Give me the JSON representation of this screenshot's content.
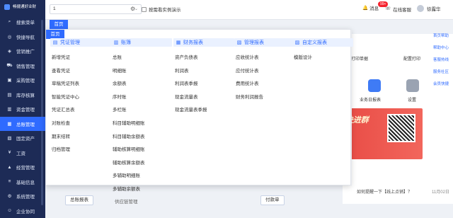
{
  "app": {
    "logo_text": "畅捷通好业财"
  },
  "sidebar": {
    "items": [
      {
        "label": "搜索菜单",
        "icon": "search-icon"
      },
      {
        "label": "快捷导航",
        "icon": "compass-icon"
      },
      {
        "label": "营销推广",
        "icon": "megaphone-icon"
      },
      {
        "label": "销售管理",
        "icon": "cart-icon"
      },
      {
        "label": "采购管理",
        "icon": "bag-icon"
      },
      {
        "label": "库存核算",
        "icon": "box-icon"
      },
      {
        "label": "资金管理",
        "icon": "wallet-icon"
      },
      {
        "label": "总账管理",
        "icon": "ledger-icon",
        "active": true
      },
      {
        "label": "固定资产",
        "icon": "building-icon"
      },
      {
        "label": "工资",
        "icon": "salary-icon"
      },
      {
        "label": "经营管理",
        "icon": "chart-icon"
      },
      {
        "label": "基础信息",
        "icon": "database-icon"
      },
      {
        "label": "系统管理",
        "icon": "settings-icon"
      },
      {
        "label": "企业协同",
        "icon": "people-icon"
      }
    ]
  },
  "topbar": {
    "company_value": "1",
    "realtime_label": "按需看实例演示",
    "message_label": "消息",
    "message_badge": "99+",
    "service_label": "在线客服",
    "user_name": "徐露华"
  },
  "main": {
    "home_tab": "首页",
    "print_label": "打印单据",
    "config_print": "配置打印",
    "tools": [
      {
        "label": "业务日报表"
      },
      {
        "label": "设置"
      }
    ],
    "promo_text": "官方VIP，快进群",
    "news": [
      {
        "text": "如何提醒一下【线上点销】？",
        "date": "11月02日"
      }
    ],
    "right_help": [
      "首页帮助",
      "帮助中心",
      "客服热线",
      "服务社区",
      "会员快捷"
    ],
    "flow": {
      "box1": "总账报表",
      "label1": "供应链管理",
      "box2": "付款单"
    }
  },
  "dropdown": {
    "tab_label": "首页",
    "columns": [
      {
        "title": "凭证管理",
        "icon": "voucher-icon",
        "items": [
          "新增凭证",
          "查看凭证",
          "草稿凭证列表",
          "智能凭证中心",
          "凭证汇总表",
          "对账检查",
          "期末结转",
          "归档管理"
        ]
      },
      {
        "title": "账簿",
        "icon": "book-icon",
        "items": [
          "总账",
          "明细账",
          "余额表",
          "序时账",
          "多栏账",
          "科目辅助明细账",
          "科目辅助余额表",
          "辅助核算明细账",
          "辅助核算余额表",
          "多辅助明细账",
          "多辅助余额表"
        ]
      },
      {
        "title": "财务报表",
        "icon": "report-icon",
        "items": [
          "资产负债表",
          "利润表",
          "利润表季报",
          "现金流量表",
          "现金流量表季报"
        ]
      },
      {
        "title": "管理报表",
        "icon": "manage-icon",
        "items": [
          "应收统计表",
          "应付统计表",
          "费用统计表",
          "财务利润报告"
        ]
      },
      {
        "title": "自定义报表",
        "icon": "custom-icon",
        "items": [
          "模版设计"
        ]
      }
    ]
  }
}
